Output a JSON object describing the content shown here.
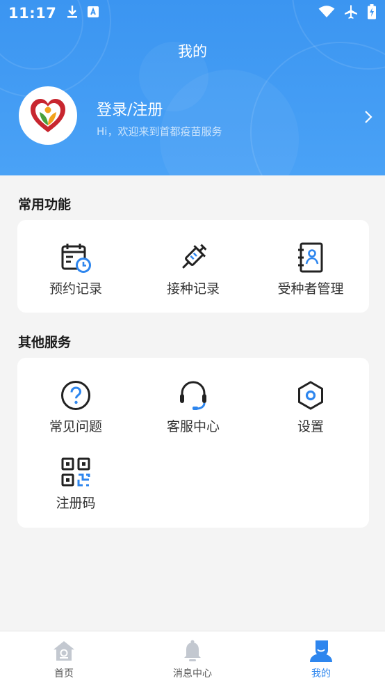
{
  "status_bar": {
    "time": "11:17"
  },
  "header": {
    "title": "我的"
  },
  "profile": {
    "name": "登录/注册",
    "subtitle": "Hi，欢迎来到首都疫苗服务"
  },
  "common": {
    "title": "常用功能",
    "items": [
      {
        "label": "预约记录",
        "icon": "calendar-clock-icon"
      },
      {
        "label": "接种记录",
        "icon": "syringe-icon"
      },
      {
        "label": "受种者管理",
        "icon": "contact-book-icon"
      }
    ]
  },
  "other": {
    "title": "其他服务",
    "items": [
      {
        "label": "常见问题",
        "icon": "question-icon"
      },
      {
        "label": "客服中心",
        "icon": "headset-icon"
      },
      {
        "label": "设置",
        "icon": "settings-hexagon-icon"
      },
      {
        "label": "注册码",
        "icon": "qr-code-icon"
      }
    ]
  },
  "tabbar": {
    "tabs": [
      {
        "label": "首页",
        "icon": "home-icon",
        "active": false
      },
      {
        "label": "消息中心",
        "icon": "bell-icon",
        "active": false
      },
      {
        "label": "我的",
        "icon": "user-icon",
        "active": true
      }
    ]
  },
  "colors": {
    "accent": "#3b95f1",
    "icon_dark": "#222222",
    "icon_blue": "#2e86ee",
    "active_tab": "#2e86ee"
  }
}
